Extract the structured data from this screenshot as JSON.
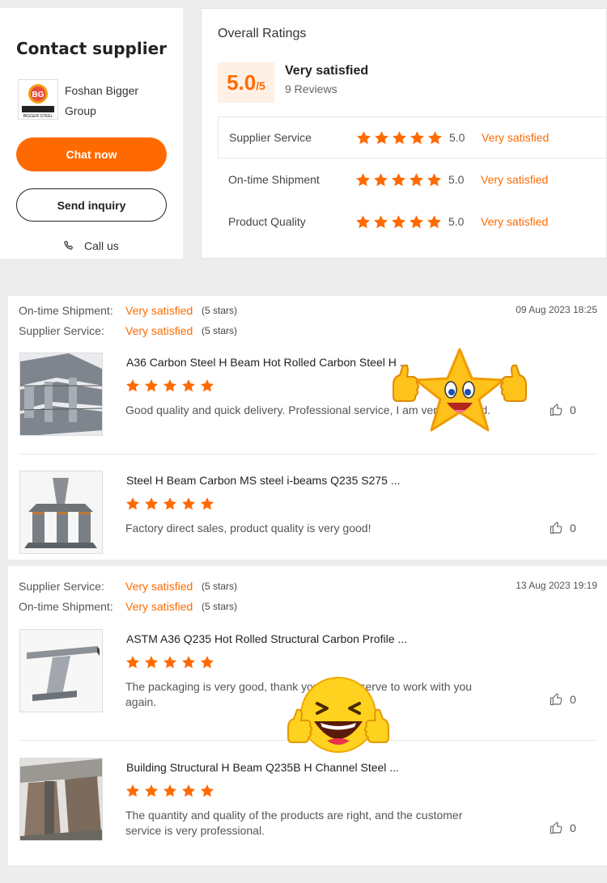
{
  "contact": {
    "title": "Contact supplier",
    "company_name": "Foshan Bigger Group",
    "chat_label": "Chat now",
    "inquiry_label": "Send inquiry",
    "call_label": "Call us",
    "logo_text": "BIGGER STEEL",
    "logo_brand_mark": "BG"
  },
  "ratings": {
    "heading": "Overall Ratings",
    "score": "5.0",
    "score_max": "/5",
    "score_label": "Very satisfied",
    "reviews_count": "9 Reviews",
    "rows": [
      {
        "label": "Supplier Service",
        "value": "5.0",
        "text": "Very satisfied",
        "stars": 5
      },
      {
        "label": "On-time Shipment",
        "value": "5.0",
        "text": "Very satisfied",
        "stars": 5
      },
      {
        "label": "Product Quality",
        "value": "5.0",
        "text": "Very satisfied",
        "stars": 5
      }
    ]
  },
  "reviews": [
    {
      "date": "09 Aug 2023 18:25",
      "meta": [
        {
          "label": "On-time Shipment:",
          "value": "Very satisfied",
          "stars": "(5 stars)"
        },
        {
          "label": "Supplier Service:",
          "value": "Very satisfied",
          "stars": "(5 stars)"
        }
      ],
      "products": [
        {
          "name": "A36 Carbon Steel H Beam Hot Rolled Carbon Steel H ...",
          "rating": 5,
          "text": "Good quality and quick delivery. Professional service, I am very satisfied.",
          "likes": "0"
        },
        {
          "name": "Steel H Beam Carbon MS steel i-beams Q235 S275 ...",
          "rating": 5,
          "text": "Factory direct sales, product quality is very good!",
          "likes": "0"
        }
      ]
    },
    {
      "date": "13 Aug 2023 19:19",
      "meta": [
        {
          "label": "Supplier Service:",
          "value": "Very satisfied",
          "stars": "(5 stars)"
        },
        {
          "label": "On-time Shipment:",
          "value": "Very satisfied",
          "stars": "(5 stars)"
        }
      ],
      "products": [
        {
          "name": "ASTM A36 Q235 Hot Rolled Structural Carbon Profile ...",
          "rating": 5,
          "text": "The packaging is very good, thank you, you deserve to work with you again.",
          "likes": "0"
        },
        {
          "name": "Building Structural H Beam Q235B H Channel Steel ...",
          "rating": 5,
          "text": "The quantity and quality of the products are right, and the customer service is very professional.",
          "likes": "0"
        }
      ]
    }
  ],
  "colors": {
    "accent": "#ff6a00",
    "accent_bg": "#fff0e6",
    "star": "#ff6a00"
  },
  "icons": {
    "phone": "phone-icon",
    "like": "thumbs-up-icon",
    "star": "star-icon"
  }
}
